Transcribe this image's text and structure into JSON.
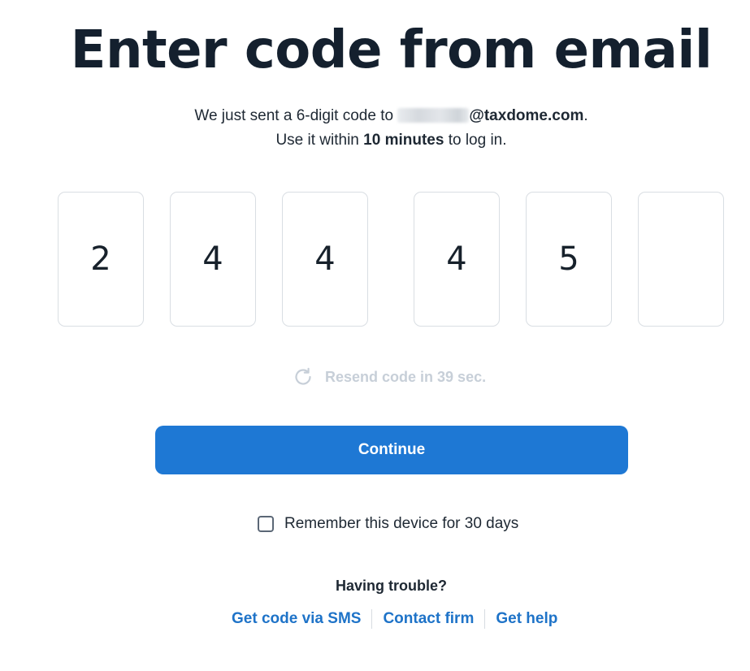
{
  "header": {
    "title": "Enter code from email"
  },
  "message": {
    "line1_prefix": "We just sent a 6-digit code to ",
    "email_domain": "@taxdome.com",
    "line1_suffix": ".",
    "line2_prefix": "Use it within ",
    "line2_bold": "10 minutes",
    "line2_suffix": " to log in."
  },
  "code": {
    "digits": [
      "2",
      "4",
      "4",
      "4",
      "5",
      ""
    ]
  },
  "resend": {
    "icon": "refresh-icon",
    "label": "Resend code in 39 sec."
  },
  "actions": {
    "continue_label": "Continue"
  },
  "remember": {
    "label": "Remember this device for 30 days",
    "checked": false
  },
  "help": {
    "heading": "Having trouble?",
    "links": [
      "Get code via SMS",
      "Contact firm",
      "Get help"
    ]
  },
  "colors": {
    "primary": "#1e78d4",
    "link": "#1e73c8",
    "disabled_text": "#c7cfd8",
    "heading": "#14202e"
  }
}
